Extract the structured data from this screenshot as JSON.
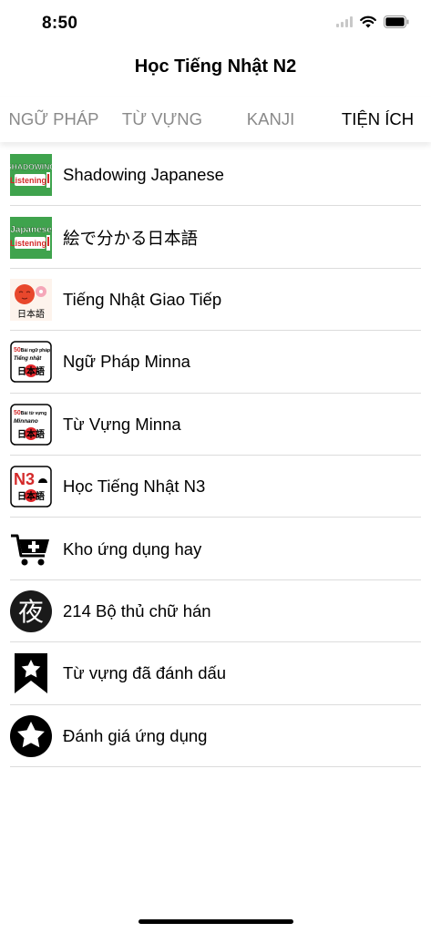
{
  "status": {
    "time": "8:50"
  },
  "nav": {
    "title": "Học Tiếng Nhật N2"
  },
  "tabs": [
    {
      "label": "NGỮ PHÁP"
    },
    {
      "label": "TỪ VỰNG"
    },
    {
      "label": "KANJI"
    },
    {
      "label": "TIỆN ÍCH",
      "active": true
    }
  ],
  "items": [
    {
      "label": "Shadowing Japanese",
      "icon": "shadowing-listening-app-icon",
      "icon_text": [
        "SHADOWING",
        "Listening"
      ]
    },
    {
      "label": "絵で分かる日本語",
      "icon": "japanese-listening-app-icon",
      "icon_text": [
        "Japanese",
        "Listening"
      ]
    },
    {
      "label": "Tiếng Nhật Giao Tiếp",
      "icon": "japanese-communication-app-icon",
      "icon_text": [
        "日本語"
      ]
    },
    {
      "label": "Ngữ Pháp Minna",
      "icon": "minna-grammar-app-icon",
      "icon_text": [
        "50Bài ngữ pháp",
        "Tiếng nhật",
        "日本語"
      ]
    },
    {
      "label": "Từ Vựng Minna",
      "icon": "minna-vocabulary-app-icon",
      "icon_text": [
        "50Bài từ vựng",
        "Minnano",
        "日本語"
      ]
    },
    {
      "label": "Học Tiếng Nhật N3",
      "icon": "n3-app-icon",
      "icon_text": [
        "N3",
        "日本語"
      ]
    },
    {
      "label": "Kho ứng dụng hay",
      "icon": "cart-plus-icon"
    },
    {
      "label": "214 Bộ thủ chữ hán",
      "icon": "kanji-radical-icon",
      "icon_text": [
        "夜"
      ]
    },
    {
      "label": "Từ vựng đã đánh dấu",
      "icon": "bookmark-star-icon"
    },
    {
      "label": "Đánh giá ứng dụng",
      "icon": "star-circle-icon"
    }
  ],
  "colors": {
    "tab_active": "#000000",
    "tab_inactive": "#8a8a8a",
    "app_green": "#3fa34d",
    "japan_red": "#e0262b"
  }
}
